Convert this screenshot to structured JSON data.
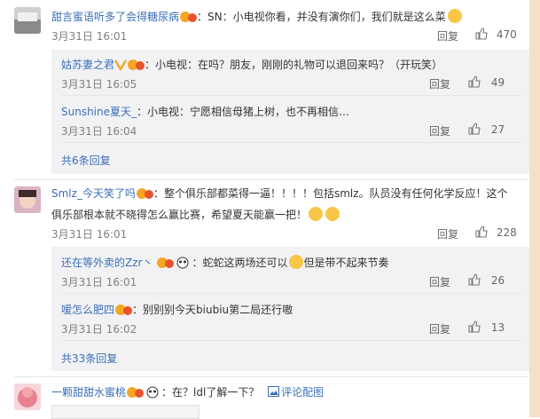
{
  "comments": [
    {
      "user": "甜言蜜语听多了会得糖尿病",
      "sep": "：",
      "text": "SN：小电视你看，并没有演你们，我们就是这么菜",
      "time": "3月31日 16:01",
      "reply_label": "回复",
      "likes": "470",
      "replies": [
        {
          "user": "姑苏妻之君",
          "sep": "：",
          "text": "小电视：在吗？朋友，刚刚的礼物可以退回来吗？（开玩笑）",
          "time": "3月31日 16:05",
          "reply_label": "回复",
          "likes": "49"
        },
        {
          "user": "Sunshine夏天_",
          "sep": "：",
          "text": "小电视：宁愿相信母猪上树，也不再相信…",
          "time": "3月31日 16:04",
          "reply_label": "回复",
          "likes": "27"
        }
      ],
      "more": "共6条回复"
    },
    {
      "user": "Smlz_今天笑了吗",
      "sep": "：",
      "text_line1": "整个俱乐部都菜得一逼！！！！包括smlz。队员没有任何化学反应！这个",
      "text_line2": "俱乐部根本就不晓得怎么赢比赛，希望夏天能赢一把！",
      "time": "3月31日 16:01",
      "reply_label": "回复",
      "likes": "228",
      "replies": [
        {
          "user": "还在等外卖的Zzr丶",
          "sep": "：",
          "text_a": "蛇蛇这两场还可以",
          "text_b": "但是带不起来节奏",
          "time": "3月31日 16:01",
          "reply_label": "回复",
          "likes": "26"
        },
        {
          "user": "嗳怎么肥四",
          "sep": "：",
          "text": "别别别今天biubiu第二局还行嗷",
          "time": "3月31日 16:02",
          "reply_label": "回复",
          "likes": "13"
        }
      ],
      "more": "共33条回复"
    },
    {
      "user": "一颗甜甜水蜜桃",
      "sep": "：",
      "text": "在？ldl了解一下？",
      "link": "评论配图"
    }
  ],
  "colors": {
    "name": "#eb7350",
    "link": "#3b6fb6",
    "reply_bg": "#f2f2f5"
  }
}
